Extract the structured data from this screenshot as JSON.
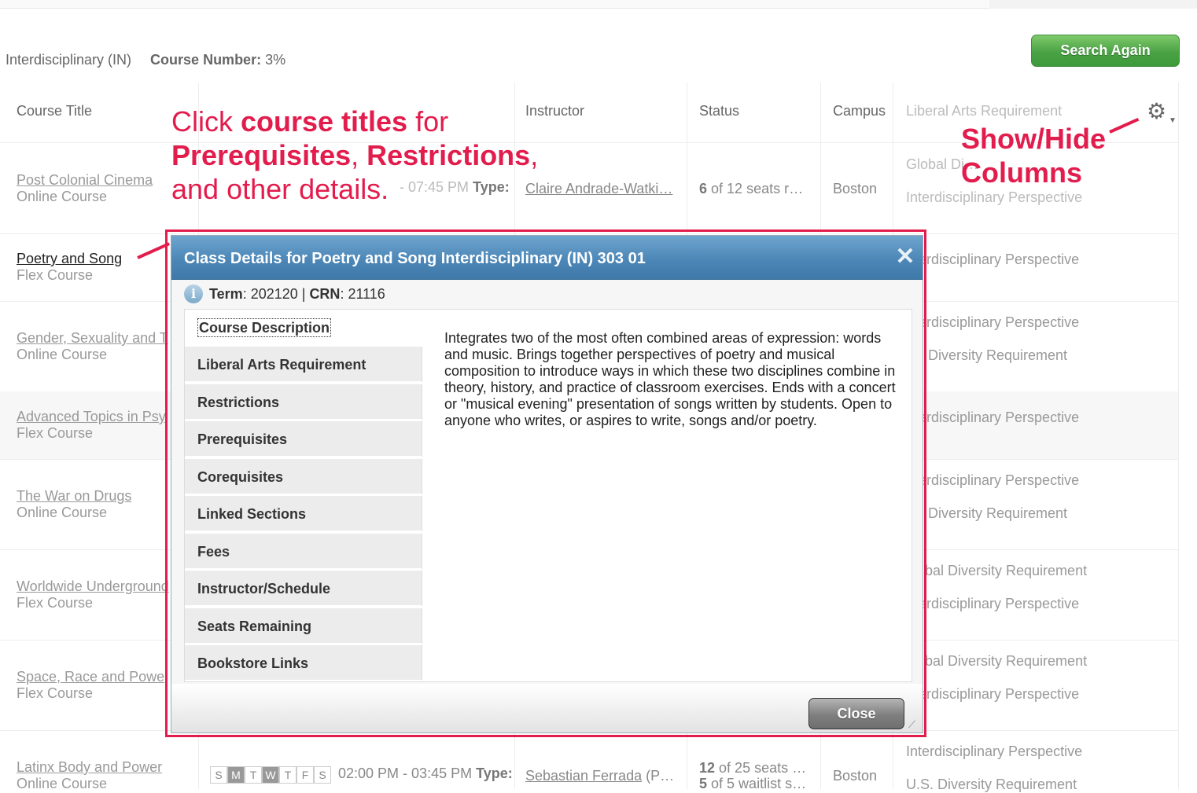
{
  "filter": {
    "subject": "Interdisciplinary (IN)",
    "course_number_label": "Course Number:",
    "course_number_value": "3%"
  },
  "search_again": "Search Again",
  "headers": {
    "title": "Course Title",
    "instructor": "Instructor",
    "status": "Status",
    "campus": "Campus",
    "lar": "Liberal Arts Requirement"
  },
  "rows": [
    {
      "title": "Post Colonial Cinema",
      "type": "Online Course",
      "time": "- 07:45 PM",
      "type_label": "Type:",
      "instructor": "Claire Andrade-Watki…",
      "status": "of 12 seats r…",
      "status_num": "6",
      "campus": "Boston",
      "lar1": "Global Di…",
      "lar2": "Interdisciplinary Perspective"
    },
    {
      "title": "Poetry and Song",
      "type": "Flex Course",
      "lar1": "erdisciplinary Perspective"
    },
    {
      "title": "Gender, Sexuality and T",
      "type": "Online Course",
      "lar1": "erdisciplinary Perspective",
      "lar2": ". Diversity Requirement"
    },
    {
      "title": "Advanced Topics in Psy",
      "type": "Flex Course",
      "lar1": "erdisciplinary Perspective"
    },
    {
      "title": "The War on Drugs",
      "type": "Online Course",
      "lar1": "erdisciplinary Perspective",
      "lar2": ". Diversity Requirement"
    },
    {
      "title": "Worldwide Underground",
      "type": "Flex Course",
      "lar1": "bal Diversity Requirement",
      "lar2": "erdisciplinary Perspective"
    },
    {
      "title": "Space, Race and Powe",
      "type": "Flex Course",
      "lar1": "bal Diversity Requirement",
      "lar2": "erdisciplinary Perspective"
    },
    {
      "title": "Latinx Body and Power",
      "type": "Online Course",
      "time": "02:00 PM - 03:45 PM",
      "type_label": "Type:",
      "instructor": "Sebastian Ferrada",
      "instructor_extra": "(P…",
      "status": "of 25 seats …",
      "status_num": "12",
      "status2": "of 5 waitlist s…",
      "status2_num": "5",
      "campus": "Boston",
      "lar1": "Interdisciplinary Perspective",
      "lar2": "U.S. Diversity Requirement"
    }
  ],
  "days": [
    "S",
    "M",
    "T",
    "W",
    "T",
    "F",
    "S"
  ],
  "annotations": {
    "left_l1_pre": "Click ",
    "left_l1_bold": "course titles",
    "left_l1_post": " for",
    "left_l2_a": "Prerequisites",
    "left_l2_sep": ", ",
    "left_l2_b": "Restrictions",
    "left_l2_end": ",",
    "left_l3": "and other details.",
    "right_l1": "Show/Hide",
    "right_l2": "Columns"
  },
  "modal": {
    "title": "Class Details for Poetry and Song Interdisciplinary (IN) 303 01",
    "term_label": "Term",
    "term_value": ": 202120 | ",
    "crn_label": "CRN",
    "crn_value": ": 21116",
    "tabs": [
      "Course Description",
      "Liberal Arts Requirement",
      "Restrictions",
      "Prerequisites",
      "Corequisites",
      "Linked Sections",
      "Fees",
      "Instructor/Schedule",
      "Seats Remaining",
      "Bookstore Links"
    ],
    "description": "Integrates two of the most often combined areas of expression: words and music. Brings together perspectives of poetry and musical composition to introduce ways in which these two disciplines combine in theory, history, and practice of classroom exercises. Ends with a concert or \"musical evening\" presentation of songs written by students. Open to anyone who writes, or aspires to write, songs and/or poetry.",
    "close": "Close"
  },
  "colors": {
    "annotation": "#e21d4d",
    "header_blue": "#4d87b7",
    "search_green": "#4aa244"
  }
}
